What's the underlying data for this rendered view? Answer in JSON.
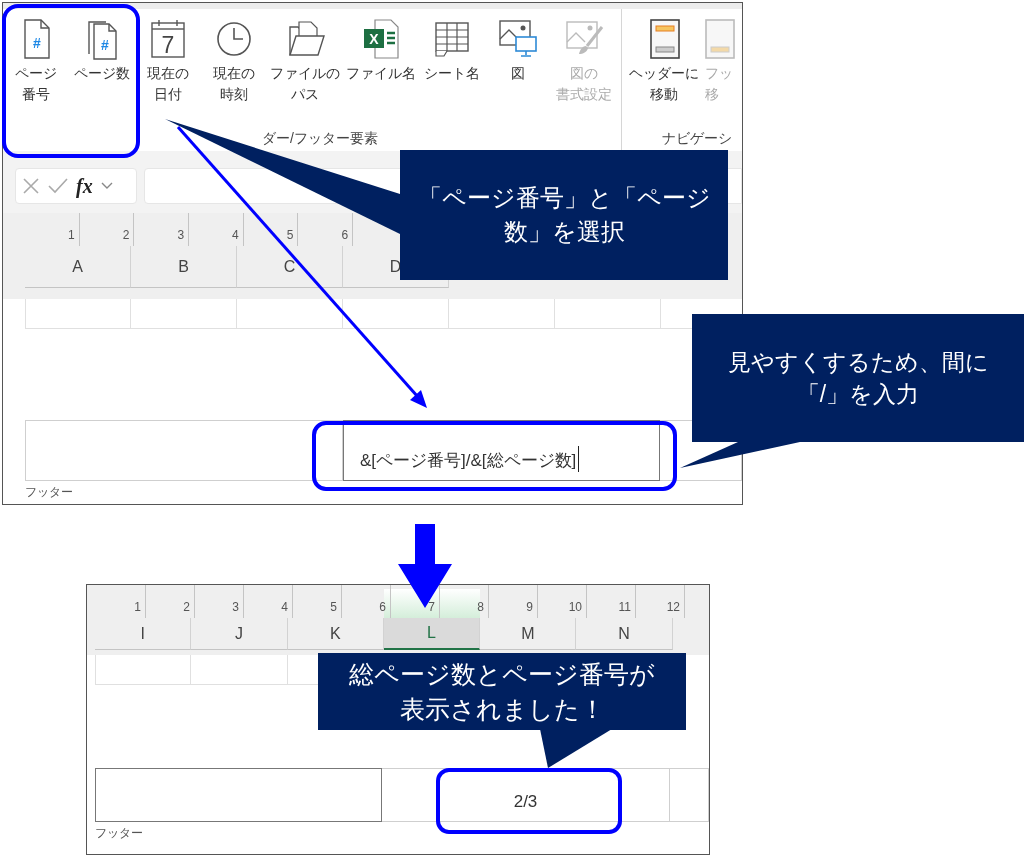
{
  "top_screenshot": {
    "ribbon": {
      "groups": [
        {
          "label": "ダー/フッター要素",
          "buttons": [
            {
              "label": "ページ番号",
              "disabled": false,
              "icon_text": "#"
            },
            {
              "label": "ページ数",
              "disabled": false,
              "icon_text": "#"
            },
            {
              "label": "現在の日付",
              "disabled": false,
              "icon_text": "7"
            },
            {
              "label": "現在の時刻",
              "disabled": false
            },
            {
              "label": "ファイルのパス",
              "disabled": false
            },
            {
              "label": "ファイル名",
              "disabled": false,
              "icon_text": "X"
            },
            {
              "label": "シート名",
              "disabled": false
            },
            {
              "label": "図",
              "disabled": false
            },
            {
              "label": "図の書式設定",
              "disabled": true
            }
          ]
        },
        {
          "label": "ナビゲーシ",
          "buttons": [
            {
              "label": "ヘッダーに移動",
              "disabled": false
            },
            {
              "label": "フッ移",
              "disabled": true
            }
          ]
        }
      ]
    },
    "formula_bar": {
      "function_label": "fx"
    },
    "ruler": [
      "1",
      "2",
      "3",
      "4",
      "5",
      "6"
    ],
    "columns": [
      {
        "label": "A",
        "selected": false
      },
      {
        "label": "B",
        "selected": false
      },
      {
        "label": "C",
        "selected": false
      },
      {
        "label": "D",
        "selected": false
      }
    ],
    "footer": {
      "label": "フッター",
      "sections": [
        {
          "selected": false
        },
        {
          "text": "&[ページ番号]/&[総ページ数]",
          "selected": true,
          "cursor": true
        },
        {
          "selected": false
        }
      ]
    }
  },
  "bottom_screenshot": {
    "ruler": [
      "1",
      "2",
      "3",
      "4",
      "5",
      "6",
      "7",
      "8",
      "9",
      "10",
      "11",
      "12"
    ],
    "columns": [
      {
        "label": "I",
        "selected": false
      },
      {
        "label": "J",
        "selected": false
      },
      {
        "label": "K",
        "selected": false
      },
      {
        "label": "L",
        "selected": true
      },
      {
        "label": "M",
        "selected": false
      },
      {
        "label": "N",
        "selected": false
      }
    ],
    "footer": {
      "label": "フッター",
      "sections": [
        {
          "selected": true
        },
        {
          "text": "2/3",
          "selected": false,
          "cursor": false
        },
        {
          "selected": false
        }
      ]
    }
  },
  "callouts": [
    {
      "text": "「ページ番号」と「ページ数」を選択"
    },
    {
      "text": "見やすくするため、間に「/」を入力"
    },
    {
      "text": "総ページ数とページ番号が表示されました！"
    }
  ]
}
